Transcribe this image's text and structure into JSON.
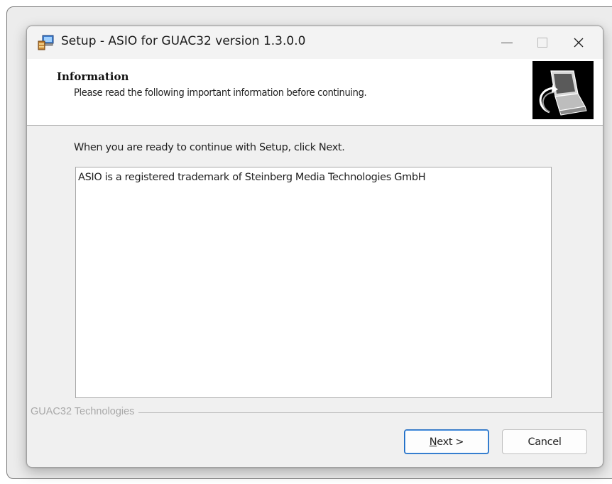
{
  "window": {
    "title": "Setup - ASIO for GUAC32 version 1.3.0.0",
    "minimize_glyph": "—",
    "maximize_glyph": "☐",
    "close_glyph": "✕"
  },
  "icons": {
    "app": "setup-installer-icon",
    "wizard_image": "computer-install-icon"
  },
  "header": {
    "title": "Information",
    "subtitle": "Please read the following important information before continuing."
  },
  "body": {
    "instruction": "When you are ready to continue with Setup, click Next.",
    "memo_text": "ASIO is a registered trademark of Steinberg Media Technologies GmbH"
  },
  "footer": {
    "brand": "GUAC32 Technologies",
    "next_accel": "N",
    "next_rest": "ext >",
    "cancel_label": "Cancel"
  },
  "colors": {
    "dialog_bg": "#f0f0f0",
    "panel_bg": "#ffffff",
    "default_button_border": "#1565c0",
    "brand_text": "#a8a8a8"
  }
}
